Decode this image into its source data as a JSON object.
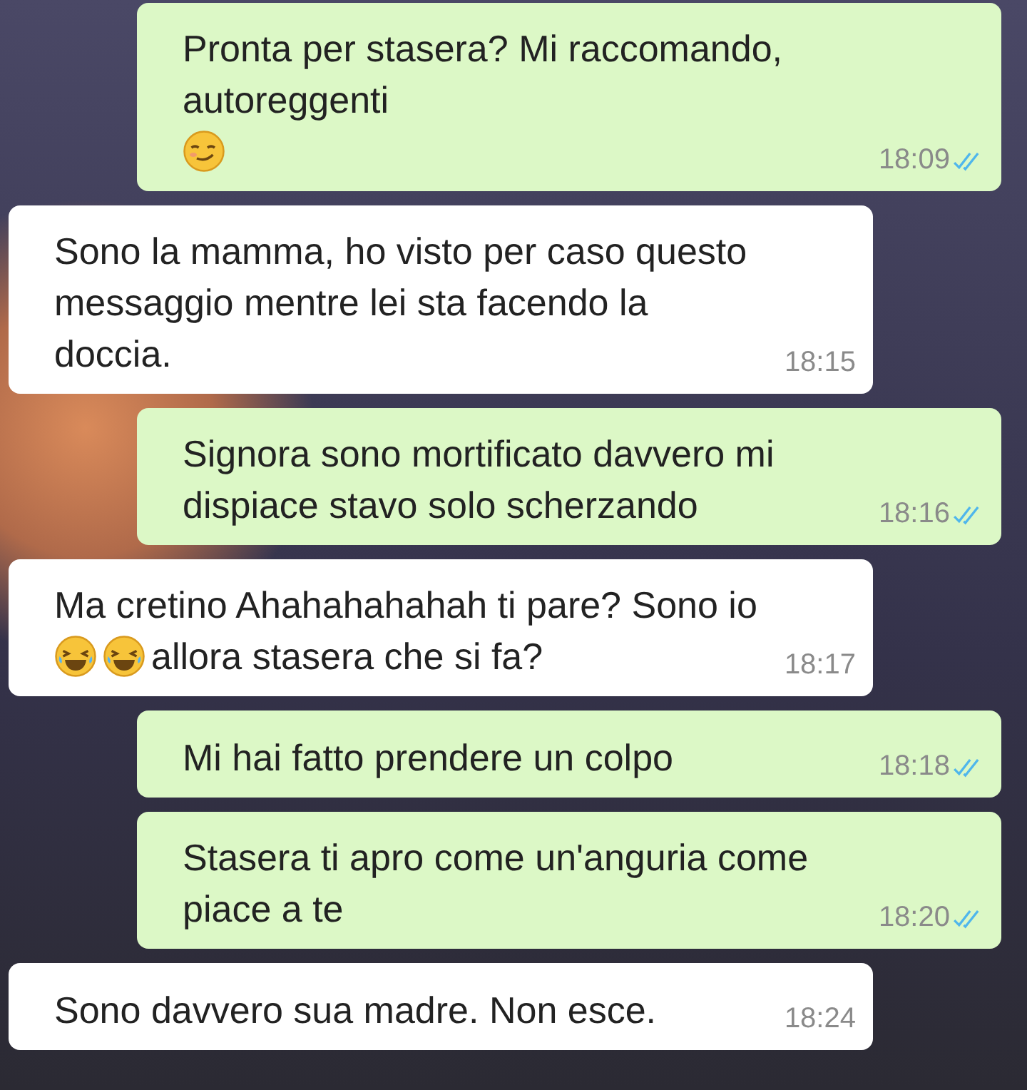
{
  "messages": [
    {
      "kind": "sent",
      "parts": [
        {
          "kind": "text",
          "text": "Pronta per stasera? Mi raccomando, autoreggenti"
        },
        {
          "kind": "smirk-emoji"
        }
      ],
      "time": "18:09",
      "read": true
    },
    {
      "kind": "received",
      "parts": [
        {
          "kind": "text",
          "text": "Sono la mamma, ho visto per caso questo messaggio mentre lei sta facendo la doccia."
        }
      ],
      "time": "18:15"
    },
    {
      "kind": "sent",
      "parts": [
        {
          "kind": "text",
          "text": "Signora sono mortificato davvero mi dispiace stavo solo scherzando"
        }
      ],
      "time": "18:16",
      "read": true
    },
    {
      "kind": "received",
      "parts": [
        {
          "kind": "text",
          "text": "Ma cretino Ahahahahahah ti pare? Sono io"
        },
        {
          "kind": "laugh-emoji"
        },
        {
          "kind": "laugh-emoji"
        },
        {
          "kind": "text",
          "text": "allora stasera che si fa?"
        }
      ],
      "time": "18:17"
    },
    {
      "kind": "sent",
      "parts": [
        {
          "kind": "text",
          "text": "Mi hai fatto prendere un colpo"
        }
      ],
      "time": "18:18",
      "read": true
    },
    {
      "kind": "sent",
      "parts": [
        {
          "kind": "text",
          "text": "Stasera ti apro come un'anguria come piace a te"
        }
      ],
      "time": "18:20",
      "read": true
    },
    {
      "kind": "received",
      "parts": [
        {
          "kind": "text",
          "text": "Sono davvero sua madre. Non esce."
        }
      ],
      "time": "18:24"
    }
  ]
}
